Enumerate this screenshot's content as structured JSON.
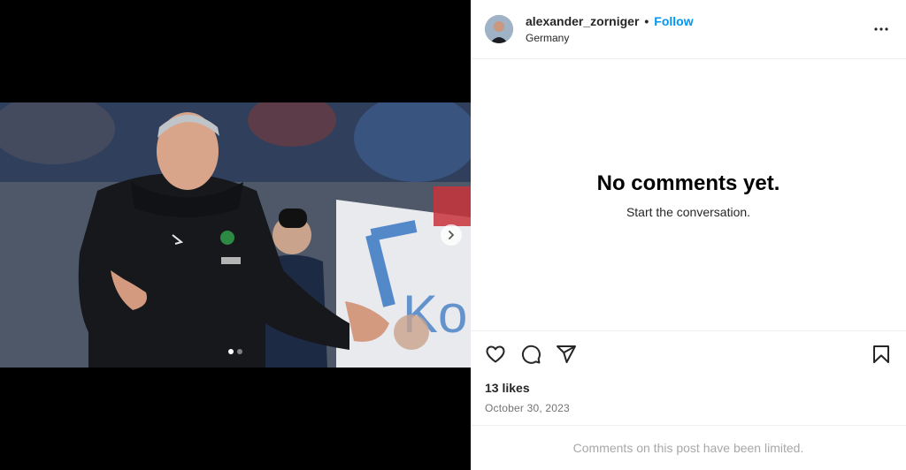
{
  "post": {
    "username": "alexander_zorniger",
    "separator": "•",
    "follow_label": "Follow",
    "location": "Germany",
    "more_icon": "more-horizontal-icon"
  },
  "media": {
    "image_description": "Coach in black jacket gesturing on sideline",
    "carousel_count": 2,
    "carousel_active": 0,
    "next_icon": "chevron-right-icon"
  },
  "comments": {
    "empty_title": "No comments yet.",
    "empty_subtitle": "Start the conversation."
  },
  "actions": {
    "like_icon": "heart-icon",
    "comment_icon": "comment-icon",
    "share_icon": "share-icon",
    "save_icon": "bookmark-icon"
  },
  "stats": {
    "likes": "13 likes",
    "date": "October 30, 2023"
  },
  "footer": {
    "limited_text": "Comments on this post have been limited."
  },
  "colors": {
    "accent": "#0095f6",
    "text": "#262626",
    "muted": "#737373"
  }
}
